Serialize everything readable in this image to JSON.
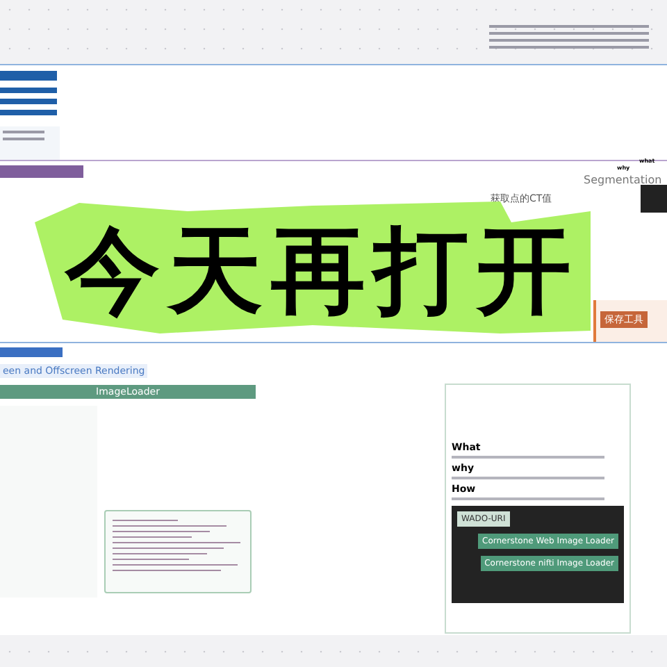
{
  "banner": {
    "title": "今天再打开"
  },
  "board_middle": {
    "ct_label": "获取点的CT值",
    "segmentation_label": "Segmentation",
    "why_label": "why",
    "what_label": "what",
    "action_button": "保存工具"
  },
  "board_bottom": {
    "tag": "een and Offscreen Rendering",
    "section_header": "ImageLoader",
    "card": {
      "sections": [
        {
          "heading": "What"
        },
        {
          "heading": "why"
        },
        {
          "heading": "How"
        }
      ],
      "diagram_boxes": [
        {
          "label": "WADO-URI",
          "kind": "plain"
        },
        {
          "label": "Cornerstone Web Image Loader",
          "kind": "green"
        },
        {
          "label": "Cornerstone nifti Image Loader",
          "kind": "green"
        }
      ]
    }
  }
}
